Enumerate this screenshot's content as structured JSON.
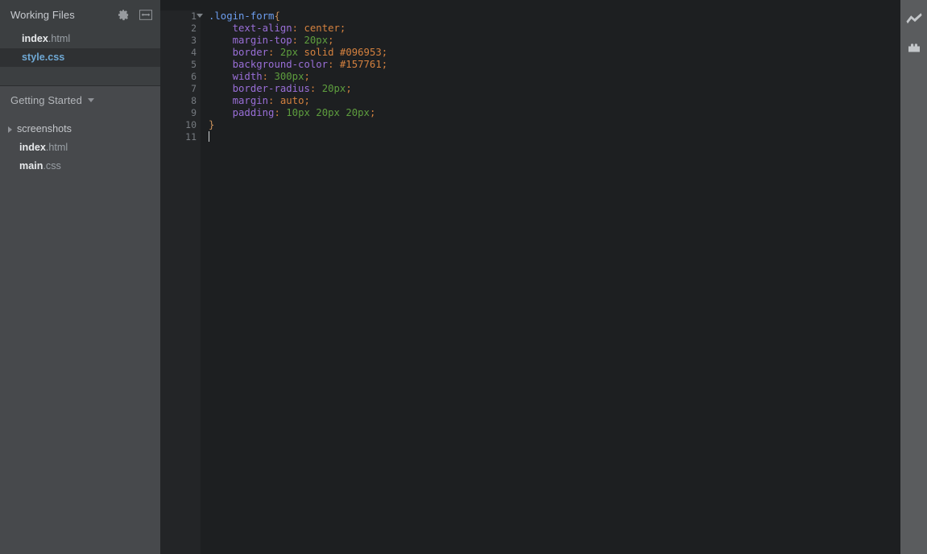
{
  "sidebar": {
    "working_files": {
      "title": "Working Files",
      "gear_icon": "gear-icon",
      "split_view_icon": "split-view-icon",
      "files": [
        {
          "base": "index",
          "ext": ".html",
          "selected": false
        },
        {
          "base": "style",
          "ext": ".css",
          "selected": true
        }
      ]
    },
    "project": {
      "name": "Getting Started",
      "caret_icon": "chevron-down-icon",
      "tree": [
        {
          "type": "folder",
          "name": "screenshots",
          "expanded": false
        },
        {
          "type": "file",
          "base": "index",
          "ext": ".html"
        },
        {
          "type": "file",
          "base": "main",
          "ext": ".css"
        }
      ]
    }
  },
  "editor": {
    "filename": "style.css",
    "cursor_line": 11,
    "line_numbers": [
      "1",
      "2",
      "3",
      "4",
      "5",
      "6",
      "7",
      "8",
      "9",
      "10",
      "11"
    ],
    "lines": [
      {
        "n": "1",
        "tokens": [
          {
            "t": ".login-form",
            "c": "tok-sel"
          },
          {
            "t": "{",
            "c": "tok-brace"
          }
        ]
      },
      {
        "n": "2",
        "tokens": [
          {
            "t": "    ",
            "c": "tok-plain"
          },
          {
            "t": "text-align",
            "c": "tok-prop"
          },
          {
            "t": ": ",
            "c": "tok-punc"
          },
          {
            "t": "center",
            "c": "tok-val"
          },
          {
            "t": ";",
            "c": "tok-punc"
          }
        ]
      },
      {
        "n": "3",
        "tokens": [
          {
            "t": "    ",
            "c": "tok-plain"
          },
          {
            "t": "margin-top",
            "c": "tok-prop"
          },
          {
            "t": ": ",
            "c": "tok-punc"
          },
          {
            "t": "20px",
            "c": "tok-num"
          },
          {
            "t": ";",
            "c": "tok-punc"
          }
        ]
      },
      {
        "n": "4",
        "tokens": [
          {
            "t": "    ",
            "c": "tok-plain"
          },
          {
            "t": "border",
            "c": "tok-prop"
          },
          {
            "t": ": ",
            "c": "tok-punc"
          },
          {
            "t": "2px",
            "c": "tok-num"
          },
          {
            "t": " ",
            "c": "tok-plain"
          },
          {
            "t": "solid",
            "c": "tok-val"
          },
          {
            "t": " ",
            "c": "tok-plain"
          },
          {
            "t": "#096953",
            "c": "tok-val"
          },
          {
            "t": ";",
            "c": "tok-punc"
          }
        ]
      },
      {
        "n": "5",
        "tokens": [
          {
            "t": "    ",
            "c": "tok-plain"
          },
          {
            "t": "background-color",
            "c": "tok-prop"
          },
          {
            "t": ": ",
            "c": "tok-punc"
          },
          {
            "t": "#157761",
            "c": "tok-val"
          },
          {
            "t": ";",
            "c": "tok-punc"
          }
        ]
      },
      {
        "n": "6",
        "tokens": [
          {
            "t": "    ",
            "c": "tok-plain"
          },
          {
            "t": "width",
            "c": "tok-prop"
          },
          {
            "t": ": ",
            "c": "tok-punc"
          },
          {
            "t": "300px",
            "c": "tok-num"
          },
          {
            "t": ";",
            "c": "tok-punc"
          }
        ]
      },
      {
        "n": "7",
        "tokens": [
          {
            "t": "    ",
            "c": "tok-plain"
          },
          {
            "t": "border-radius",
            "c": "tok-prop"
          },
          {
            "t": ": ",
            "c": "tok-punc"
          },
          {
            "t": "20px",
            "c": "tok-num"
          },
          {
            "t": ";",
            "c": "tok-punc"
          }
        ]
      },
      {
        "n": "8",
        "tokens": [
          {
            "t": "    ",
            "c": "tok-plain"
          },
          {
            "t": "margin",
            "c": "tok-prop"
          },
          {
            "t": ": ",
            "c": "tok-punc"
          },
          {
            "t": "auto",
            "c": "tok-val"
          },
          {
            "t": ";",
            "c": "tok-punc"
          }
        ]
      },
      {
        "n": "9",
        "tokens": [
          {
            "t": "    ",
            "c": "tok-plain"
          },
          {
            "t": "padding",
            "c": "tok-prop"
          },
          {
            "t": ": ",
            "c": "tok-punc"
          },
          {
            "t": "10px",
            "c": "tok-num"
          },
          {
            "t": " ",
            "c": "tok-plain"
          },
          {
            "t": "20px",
            "c": "tok-num"
          },
          {
            "t": " ",
            "c": "tok-plain"
          },
          {
            "t": "20px",
            "c": "tok-num"
          },
          {
            "t": ";",
            "c": "tok-punc"
          }
        ]
      },
      {
        "n": "10",
        "tokens": [
          {
            "t": "}",
            "c": "tok-brace"
          }
        ]
      },
      {
        "n": "11",
        "tokens": []
      }
    ],
    "code_text": ".login-form{\n    text-align: center;\n    margin-top: 20px;\n    border: 2px solid #096953;\n    background-color: #157761;\n    width: 300px;\n    border-radius: 20px;\n    margin: auto;\n    padding: 10px 20px 20px;\n}\n"
  },
  "toolbar": {
    "buttons": [
      {
        "icon": "live-preview-icon",
        "label": "Live Preview"
      },
      {
        "icon": "extension-manager-icon",
        "label": "Extension Manager"
      }
    ]
  },
  "colors": {
    "sidebar_bg": "#47494c",
    "working_files_bg": "#3c3f41",
    "selected_file_bg": "#2f3133",
    "editor_bg": "#1d1f21",
    "gutter_bg": "#232527",
    "toolbar_bg": "#5a5c5e",
    "selector_color": "#6d9ef0",
    "property_color": "#9a6fd8",
    "value_color": "#d4813f",
    "number_color": "#5e9e3e",
    "selected_file_text": "#6fa8d4"
  }
}
